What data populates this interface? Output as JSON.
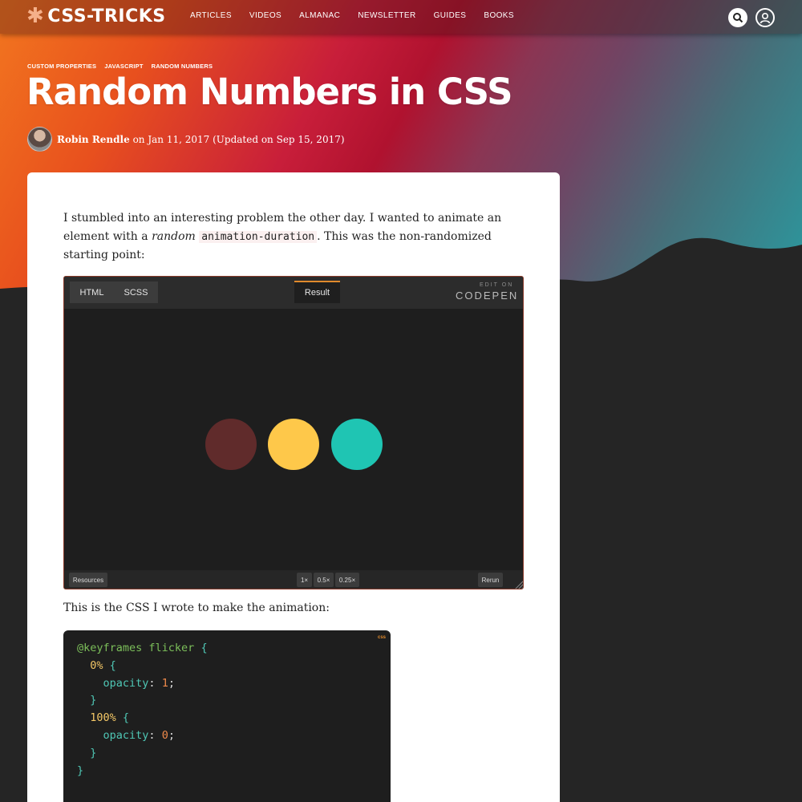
{
  "site": {
    "logo_text": "CSS-TRICKS",
    "nav": [
      "ARTICLES",
      "VIDEOS",
      "ALMANAC",
      "NEWSLETTER",
      "GUIDES",
      "BOOKS"
    ],
    "icons": [
      "search-icon",
      "user-icon"
    ]
  },
  "article": {
    "tags": [
      "CUSTOM PROPERTIES",
      "JAVASCRIPT",
      "RANDOM NUMBERS"
    ],
    "title": "Random Numbers in CSS",
    "author": "Robin Rendle",
    "date_text": " on Jan 11, 2017 (Updated on Sep 15, 2017)",
    "para1_a": "I stumbled into an interesting problem the other day. I wanted to animate an element with a ",
    "para1_em": "random",
    "para1_code": "animation-duration",
    "para1_b": ". This was the non-randomized starting point:",
    "para2": "This is the CSS I wrote to make the animation:"
  },
  "codepen": {
    "tabs": [
      "HTML",
      "SCSS"
    ],
    "result_tab": "Result",
    "edit_on": "EDIT ON",
    "brand": "CODEPEN",
    "resources": "Resources",
    "zoom": [
      "1×",
      "0.5×",
      "0.25×"
    ],
    "rerun": "Rerun",
    "circle_colors": [
      "#602b2b",
      "#fec84a",
      "#1fc5b3"
    ]
  },
  "code": {
    "lang": "css",
    "lines": [
      {
        "parts": [
          [
            "c-green",
            "@keyframes flicker "
          ],
          [
            "c-cyan",
            "{"
          ]
        ]
      },
      {
        "parts": [
          [
            "",
            "  "
          ],
          [
            "c-yellow",
            "0%"
          ],
          [
            "c-cyan",
            " {"
          ]
        ]
      },
      {
        "parts": [
          [
            "",
            "    "
          ],
          [
            "c-cyan",
            "opacity"
          ],
          [
            "",
            ": "
          ],
          [
            "c-orange",
            "1"
          ],
          [
            "",
            ";"
          ]
        ]
      },
      {
        "parts": [
          [
            "",
            "  "
          ],
          [
            "c-cyan",
            "}"
          ]
        ]
      },
      {
        "parts": [
          [
            "",
            "  "
          ],
          [
            "c-yellow",
            "100%"
          ],
          [
            "c-cyan",
            " {"
          ]
        ]
      },
      {
        "parts": [
          [
            "",
            "    "
          ],
          [
            "c-cyan",
            "opacity"
          ],
          [
            "",
            ": "
          ],
          [
            "c-orange",
            "0"
          ],
          [
            "",
            ";"
          ]
        ]
      },
      {
        "parts": [
          [
            "",
            "  "
          ],
          [
            "c-cyan",
            "}"
          ]
        ]
      },
      {
        "parts": [
          [
            "c-cyan",
            "}"
          ]
        ]
      }
    ]
  }
}
